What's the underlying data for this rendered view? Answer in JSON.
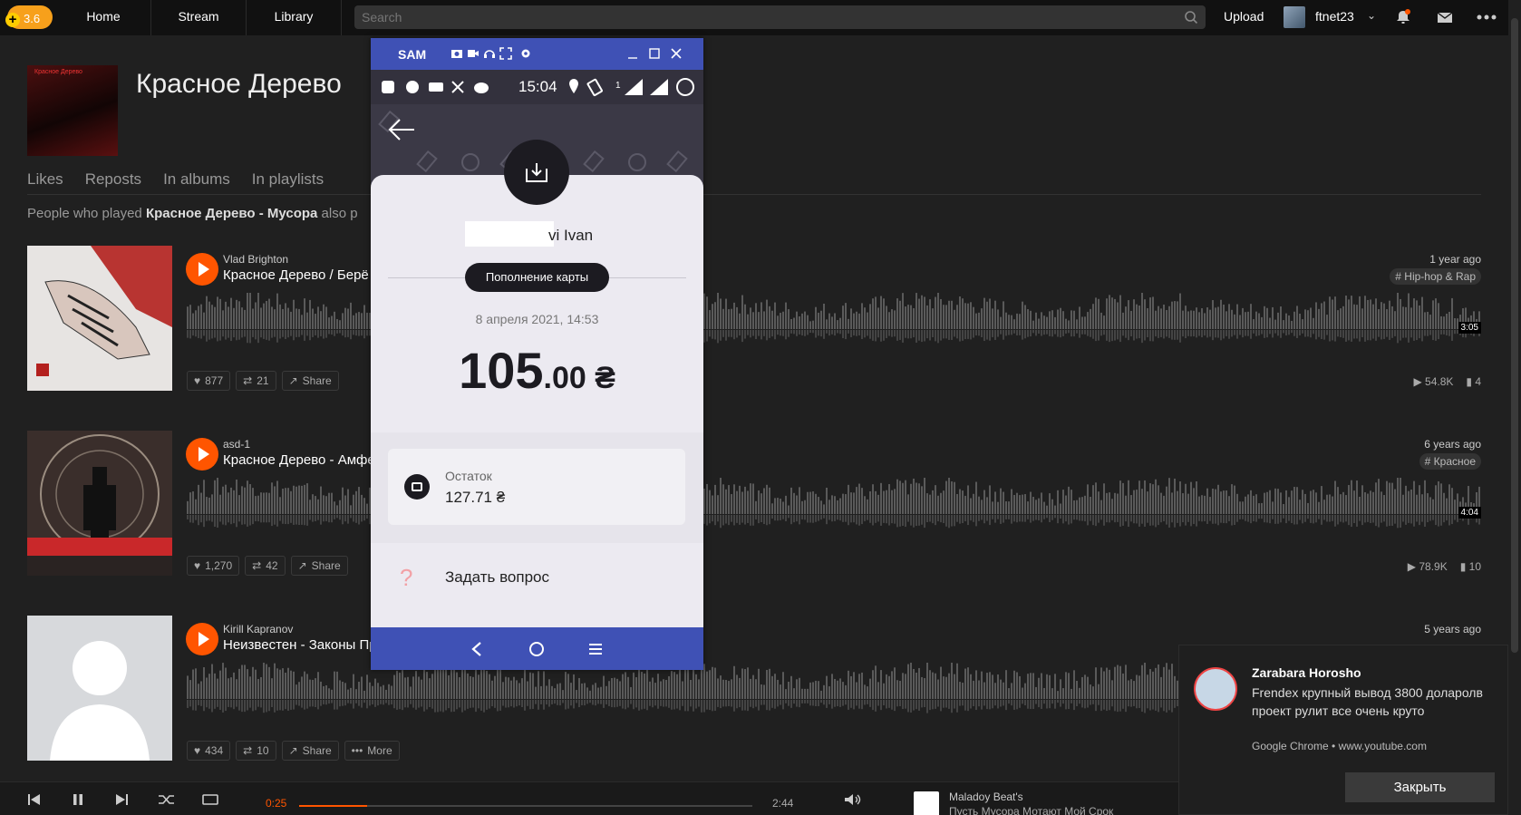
{
  "app": {
    "logo_version": "3.6",
    "nav": [
      "Home",
      "Stream",
      "Library"
    ],
    "search_placeholder": "Search",
    "upload": "Upload",
    "username": "ftnet23"
  },
  "artist": {
    "title": "Красное Дерево",
    "tabs": [
      "Likes",
      "Reposts",
      "In albums",
      "In playlists"
    ],
    "people_prefix": "People who played ",
    "people_track": "Красное Дерево - Мусора",
    "people_suffix": " also p"
  },
  "tracks": [
    {
      "user": "Vlad Brighton",
      "title": "Красное Дерево / Берё",
      "ago": "1 year ago",
      "tag": "# Hip-hop & Rap",
      "duration": "3:05",
      "likes": "877",
      "reposts": "21",
      "share": "Share",
      "plays": "54.8K",
      "comments": "4"
    },
    {
      "user": "asd-1",
      "title": "Красное Дерево - Амфе",
      "ago": "6 years ago",
      "tag": "# Красное",
      "duration": "4:04",
      "likes": "1,270",
      "reposts": "42",
      "share": "Share",
      "plays": "78.9K",
      "comments": "10"
    },
    {
      "user": "Kirill Kapranov",
      "title": "Неизвестен - Законы Пр",
      "ago": "5 years ago",
      "likes": "434",
      "reposts": "10",
      "share": "Share",
      "more": "More"
    }
  ],
  "player": {
    "elapsed": "0:25",
    "total": "2:44",
    "progress": 0.15,
    "artist": "Maladoy Beat's",
    "title": "Пусть Мусора Мотают Мой Срок"
  },
  "emulator": {
    "name": "SAM",
    "time": "15:04",
    "signal_label": "1",
    "recipient_suffix": "vi Ivan",
    "pill": "Пополнение карты",
    "date": "8 апреля 2021, 14:53",
    "amount_int": "105",
    "amount_dec": ".00 ₴",
    "balance_label": "Остаток",
    "balance_value": "127.71 ₴",
    "ask": "Задать вопрос"
  },
  "notification": {
    "title": "Zarabara Horosho",
    "body": "Frendex крупный вывод 3800 доларолв проект рулит все очень круто",
    "source": "Google Chrome • www.youtube.com",
    "close": "Закрыть"
  },
  "colors": {
    "accent": "#ff5500",
    "emulator_bar": "#3f51b5"
  }
}
